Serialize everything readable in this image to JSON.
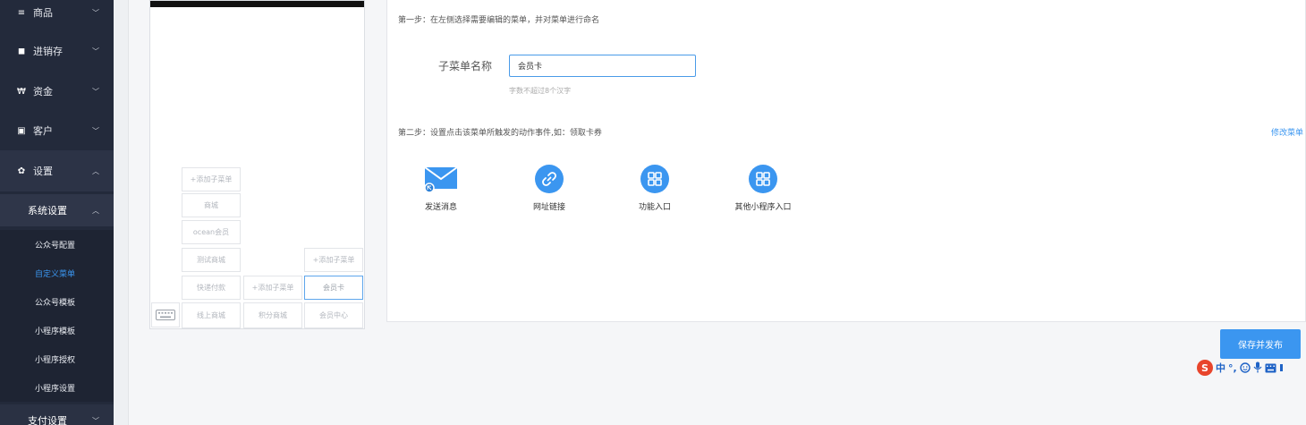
{
  "sidebar": {
    "items": [
      {
        "icon": "≡",
        "label": "商品",
        "chevron": "﹀"
      },
      {
        "icon": "◼",
        "label": "进销存",
        "chevron": "﹀"
      },
      {
        "icon": "₩",
        "label": "资金",
        "chevron": "﹀"
      },
      {
        "icon": "▣",
        "label": "客户",
        "chevron": "﹀"
      },
      {
        "icon": "✿",
        "label": "设置",
        "chevron": "︿"
      }
    ],
    "system_settings": {
      "label": "系统设置",
      "chevron": "︿"
    },
    "sub_items": [
      "公众号配置",
      "自定义菜单",
      "公众号模板",
      "小程序模板",
      "小程序授权",
      "小程序设置"
    ],
    "payment_settings": {
      "label": "支付设置",
      "chevron": "﹀"
    }
  },
  "phone_menu": {
    "col1": [
      "+添加子菜单",
      "商城",
      "ocean会员",
      "测试商城",
      "快递付款"
    ],
    "col2": [
      "+添加子菜单"
    ],
    "col3": [
      "+添加子菜单",
      "会员卡"
    ],
    "bottom": [
      "线上商城",
      "积分商城",
      "会员中心"
    ]
  },
  "editor": {
    "step1": "第一步：在左侧选择需要编辑的菜单，并对菜单进行命名",
    "name_label": "子菜单名称",
    "name_value": "会员卡",
    "name_hint": "字数不超过8个汉字",
    "step2": "第二步：设置点击该菜单所触发的动作事件,如：领取卡券",
    "edit_menu": "修改菜单",
    "actions": [
      "发送消息",
      "网址链接",
      "功能入口",
      "其他小程序入口"
    ]
  },
  "save_button": "保存并发布",
  "ime": {
    "logo": "S",
    "lang": "中",
    "punct": "°,"
  },
  "colors": {
    "accent": "#3b96f0",
    "sidebar": "#232a3b"
  }
}
